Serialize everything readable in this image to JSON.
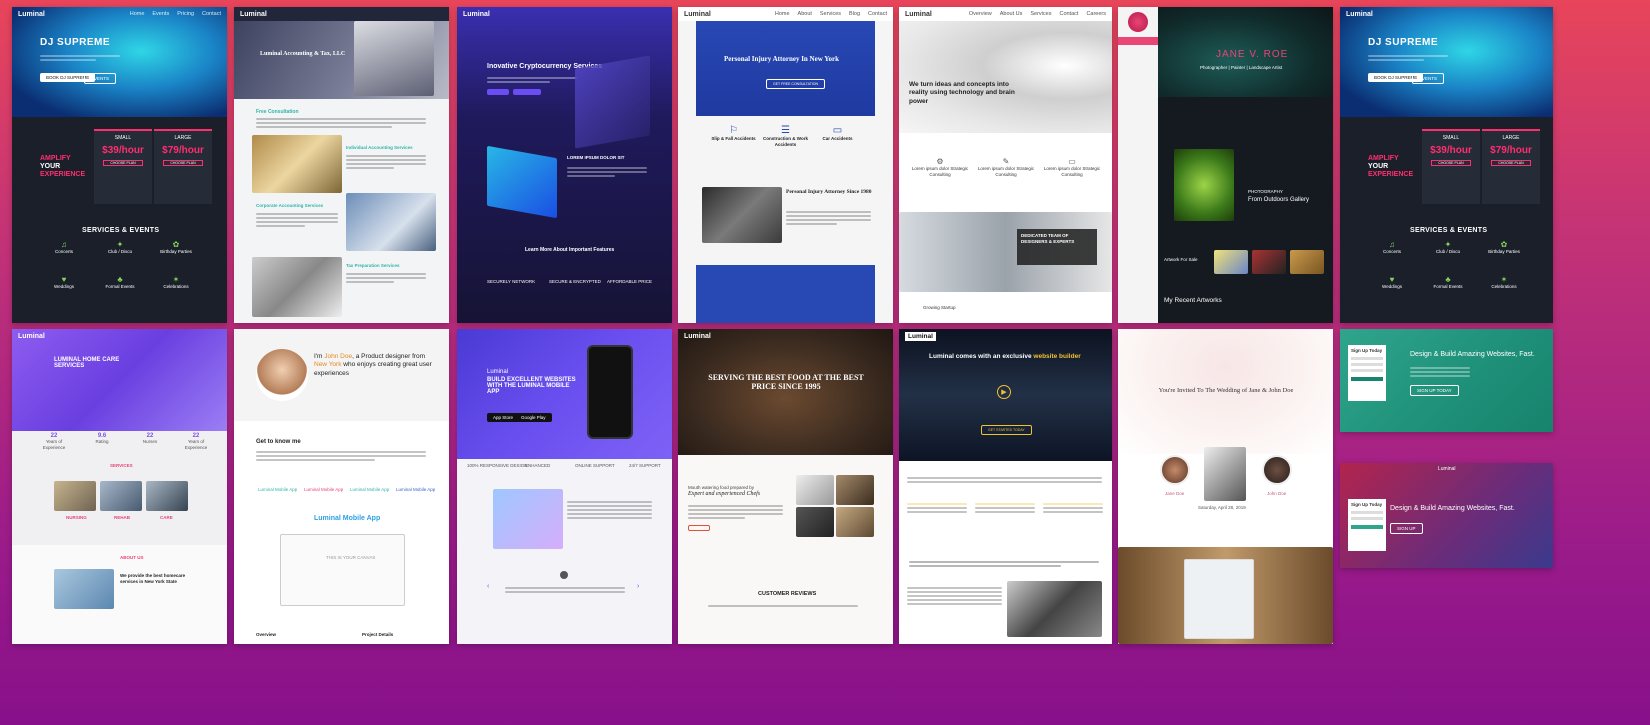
{
  "page": {
    "background_top": "#e8455a",
    "background_bottom": "#87108a"
  },
  "dj1": {
    "logo": "Luminal",
    "nav": [
      "Home",
      "Events",
      "Pricing",
      "Contact"
    ],
    "title": "DJ SUPREME",
    "buttons": [
      "BOOK DJ SUPREME",
      "EVENTS"
    ],
    "amplify": [
      "AMPLIFY",
      "YOUR",
      "EXPERIENCE"
    ],
    "plans": [
      {
        "name": "SMALL",
        "price": "$39/hour",
        "cta": "CHOOSE PLAN"
      },
      {
        "name": "LARGE",
        "price": "$79/hour",
        "cta": "CHOOSE PLAN"
      }
    ],
    "services_title": "SERVICES & EVENTS",
    "services": [
      "Concerts",
      "Club / Disco",
      "Birthday Parties",
      "Weddings",
      "Formal Events",
      "Celebrations"
    ]
  },
  "accounting": {
    "logo": "Luminal",
    "title": "Luminal Accounting & Tax, LLC",
    "sections": [
      "Free Consultation",
      "Individual Accounting Services",
      "Corporate Accounting Services",
      "Tax Preparation Services"
    ]
  },
  "crypto": {
    "logo": "Luminal",
    "title": "Inovative Cryptocurrency Services",
    "subtitle": "LOREM IPSUM DOLOR SIT",
    "bottom_title": "Learn More About Important Features",
    "features": [
      "SECURELY NETWORK",
      "SECURE & ENCRYPTED",
      "AFFORDABLE PRICE"
    ]
  },
  "attorney": {
    "logo": "Luminal",
    "nav": [
      "Home",
      "About",
      "Services",
      "Blog",
      "Contact"
    ],
    "title": "Personal Injury Attorney In New York",
    "cta": "GET FREE CONSULTATION",
    "services": [
      "Slip & Fall Accidents",
      "Construction & Work Accidents",
      "Car Accidents"
    ],
    "section_title": "Personal Injury Attorney Since 1980"
  },
  "ideas": {
    "logo": "Luminal",
    "nav": [
      "Overview",
      "About Us",
      "Services",
      "Contact",
      "Careers"
    ],
    "headline": "We turn ideas and concepts into reality using technology and brain power",
    "features": [
      "Lorem ipsum dolor Strategic Consulting",
      "Lorem ipsum dolor Strategic Consulting",
      "Lorem ipsum dolor Strategic Consulting"
    ],
    "overlay": "DEDICATED TEAM OF DESIGNERS & EXPERTS",
    "footer": "Growing Startup"
  },
  "portfolio": {
    "name": "JANE V. ROE",
    "subtitle": "Photographer | Painter | Landscape Artist",
    "gallery_label": "PHOTOGRAPHY",
    "gallery_title": "From Outdoors Gallery",
    "artworks_label": "Artwork For Sale",
    "recent": "My Recent Artworks"
  },
  "dj2": {
    "logo": "Luminal",
    "title": "DJ SUPREME",
    "buttons": [
      "BOOK DJ SUPREME",
      "EVENTS"
    ],
    "amplify": [
      "AMPLIFY",
      "YOUR",
      "EXPERIENCE"
    ],
    "plans": [
      {
        "name": "SMALL",
        "price": "$39/hour",
        "cta": "CHOOSE PLAN"
      },
      {
        "name": "LARGE",
        "price": "$79/hour",
        "cta": "CHOOSE PLAN"
      }
    ],
    "services_title": "SERVICES & EVENTS",
    "services": [
      "Concerts",
      "Club / Disco",
      "Birthday Parties",
      "Weddings",
      "Formal Events",
      "Celebrations"
    ]
  },
  "homecare": {
    "logo": "Luminal",
    "title": "LUMINAL HOME CARE SERVICES",
    "stats": [
      {
        "value": "22",
        "label": "Years of Experience"
      },
      {
        "value": "9.6",
        "label": "Rating"
      },
      {
        "value": "22",
        "label": "Nurses"
      },
      {
        "value": "22",
        "label": "Years of Experience"
      }
    ],
    "services_label": "SERVICES",
    "services": [
      "NURSING",
      "REHAB",
      "CARE"
    ],
    "about_label": "ABOUT US",
    "about_title": "We provide the best homecare services in New York State"
  },
  "designer": {
    "intro_prefix": "I'm ",
    "name": "John Doe",
    "intro_mid": ", a Product designer from ",
    "city": "New York",
    "intro_end": " who enjoys creating great user experiences",
    "know": "Get to know me",
    "skills": [
      "Luminal Mobile App",
      "Luminal Mobile App",
      "Luminal Mobile App",
      "Luminal Mobile App"
    ],
    "app_title": "Luminal Mobile App",
    "canvas_text": "THIS IS YOUR CANVAS",
    "footer": [
      "Overview",
      "Project Details"
    ]
  },
  "mobileapp": {
    "logo": "Luminal",
    "title": "BUILD EXCELLENT WEBSITES WITH THE LUMINAL MOBILE APP",
    "store_buttons": [
      "App Store",
      "Google Play"
    ],
    "features": [
      "100% RESPONSIVE DESIGN",
      "ENHANCED",
      "ONLINE SUPPORT",
      "24/7 SUPPORT"
    ]
  },
  "restaurant": {
    "logo": "Luminal",
    "title": "SERVING THE BEST FOOD AT THE BEST PRICE SINCE 1995",
    "subhead": "Mouth watering food prepared by",
    "chefs": "Expert and experienced Chefs",
    "reviews": "CUSTOMER REVIEWS"
  },
  "builder": {
    "logo": "Luminal",
    "prefix": "Luminal comes with an exclusive ",
    "highlight": "website builder",
    "cta": "GET STARTED TODAY"
  },
  "wedding": {
    "title": "You're Invited To The Wedding of Jane & John Doe",
    "people": [
      "Jane Doe",
      "John Doe"
    ],
    "date_label": "Saturday, April 28, 2019"
  },
  "green": {
    "title": "Design & Build Amazing Websites, Fast.",
    "form_title": "Sign Up Today",
    "cta": "SIGN UP TODAY"
  },
  "red": {
    "logo": "Luminal",
    "title": "Design & Build Amazing Websites, Fast.",
    "form_title": "Sign Up Today",
    "cta": "SIGN UP"
  }
}
